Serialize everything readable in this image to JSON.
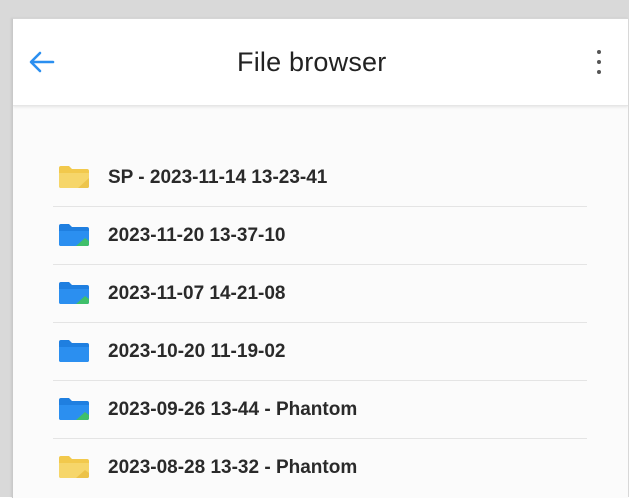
{
  "header": {
    "title": "File browser",
    "back_icon": "arrow-left-icon",
    "menu_icon": "more-vertical-icon"
  },
  "folders": [
    {
      "label": "SP - 2023-11-14 13-23-41",
      "icon": "folder-yellow-icon",
      "color": "#f2c94c"
    },
    {
      "label": "2023-11-20 13-37-10",
      "icon": "folder-blue-icon",
      "color": "#2b8ff0"
    },
    {
      "label": "2023-11-07 14-21-08",
      "icon": "folder-blue-icon",
      "color": "#2b8ff0"
    },
    {
      "label": "2023-10-20 11-19-02",
      "icon": "folder-blue-icon",
      "color": "#2b8ff0"
    },
    {
      "label": "2023-09-26 13-44 - Phantom",
      "icon": "folder-blue-icon",
      "color": "#2b8ff0"
    },
    {
      "label": "2023-08-28 13-32 - Phantom",
      "icon": "folder-yellow-icon",
      "color": "#f2c94c"
    }
  ],
  "colors": {
    "accent": "#2b8ff0",
    "folder_blue": "#2b8ff0",
    "folder_yellow": "#f2c94c",
    "text": "#2a2a2a"
  }
}
